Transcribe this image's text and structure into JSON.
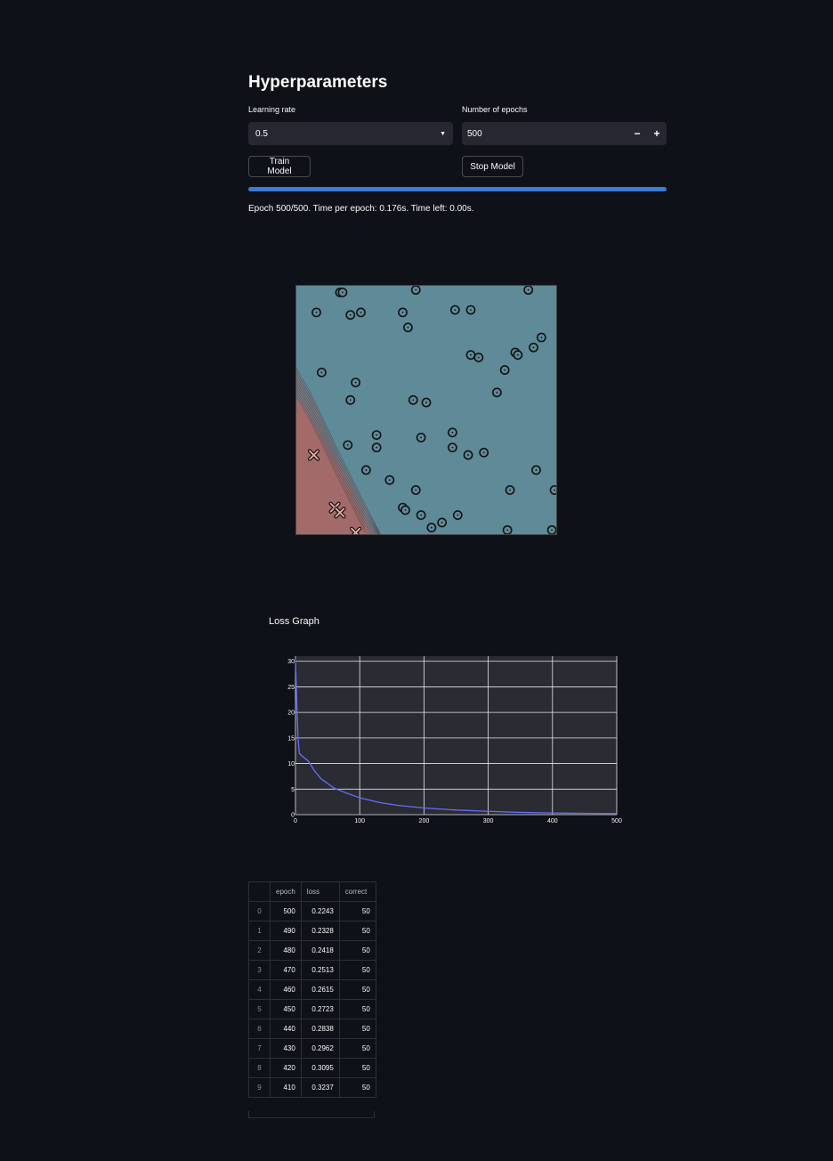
{
  "header": {
    "title": "Hyperparameters"
  },
  "learning_rate": {
    "label": "Learning rate",
    "value": "0.5"
  },
  "epochs": {
    "label": "Number of epochs",
    "value": "500",
    "minus": "−",
    "plus": "+"
  },
  "buttons": {
    "train": "Train Model",
    "stop": "Stop Model"
  },
  "progress": {
    "fraction": 1.0
  },
  "status": "Epoch 500/500. Time per epoch: 0.176s. Time left: 0.00s.",
  "colors": {
    "accent": "#3a7bd5",
    "class_blue": "#5f8a98",
    "class_red": "#a36a6a",
    "line": "#636efa",
    "plot_bg": "#2a2b33"
  },
  "scatter_data": {
    "type": "scatter",
    "classes": [
      "circle",
      "cross"
    ],
    "circles": [
      [
        0.17,
        0.03
      ],
      [
        0.18,
        0.03
      ],
      [
        0.46,
        0.02
      ],
      [
        0.89,
        0.02
      ],
      [
        0.08,
        0.11
      ],
      [
        0.21,
        0.12
      ],
      [
        0.25,
        0.11
      ],
      [
        0.41,
        0.11
      ],
      [
        0.61,
        0.1
      ],
      [
        0.67,
        0.1
      ],
      [
        0.43,
        0.17
      ],
      [
        0.94,
        0.21
      ],
      [
        0.84,
        0.27
      ],
      [
        0.85,
        0.28
      ],
      [
        0.91,
        0.25
      ],
      [
        0.67,
        0.28
      ],
      [
        0.7,
        0.29
      ],
      [
        0.8,
        0.34
      ],
      [
        0.1,
        0.35
      ],
      [
        0.23,
        0.39
      ],
      [
        0.21,
        0.46
      ],
      [
        0.45,
        0.46
      ],
      [
        0.5,
        0.47
      ],
      [
        0.77,
        0.43
      ],
      [
        0.31,
        0.6
      ],
      [
        0.2,
        0.64
      ],
      [
        0.31,
        0.65
      ],
      [
        0.48,
        0.61
      ],
      [
        0.6,
        0.59
      ],
      [
        0.6,
        0.65
      ],
      [
        0.66,
        0.68
      ],
      [
        0.72,
        0.67
      ],
      [
        0.27,
        0.74
      ],
      [
        0.36,
        0.78
      ],
      [
        0.46,
        0.82
      ],
      [
        0.82,
        0.82
      ],
      [
        0.92,
        0.74
      ],
      [
        0.99,
        0.82
      ],
      [
        0.41,
        0.89
      ],
      [
        0.42,
        0.9
      ],
      [
        0.48,
        0.92
      ],
      [
        0.56,
        0.95
      ],
      [
        0.62,
        0.92
      ],
      [
        0.52,
        0.97
      ],
      [
        0.81,
        0.98
      ],
      [
        0.98,
        0.98
      ]
    ],
    "crosses": [
      [
        0.07,
        0.68
      ],
      [
        0.15,
        0.89
      ],
      [
        0.17,
        0.91
      ],
      [
        0.23,
        0.99
      ]
    ]
  },
  "loss_title": "Loss Graph",
  "chart_data": {
    "type": "line",
    "title": "",
    "xlabel": "",
    "ylabel": "",
    "xlim": [
      0,
      500
    ],
    "ylim": [
      0,
      31
    ],
    "xticks": [
      "0",
      "100",
      "200",
      "300",
      "400",
      "500"
    ],
    "yticks": [
      "0",
      "5",
      "10",
      "15",
      "20",
      "25",
      "30"
    ],
    "grid": true,
    "series": [
      {
        "x": [
          0,
          2,
          4,
          6,
          10,
          20,
          30,
          40,
          60,
          80,
          100,
          130,
          160,
          200,
          250,
          300,
          350,
          400,
          450,
          500
        ],
        "y": [
          30.5,
          22,
          15,
          12,
          11.5,
          10.5,
          8.5,
          7,
          5.2,
          4.2,
          3.3,
          2.4,
          1.8,
          1.3,
          0.9,
          0.65,
          0.45,
          0.32,
          0.26,
          0.22
        ]
      }
    ]
  },
  "table": {
    "columns": [
      "",
      "epoch",
      "loss",
      "correct"
    ],
    "rows": [
      [
        "0",
        "500",
        "0.2243",
        "50"
      ],
      [
        "1",
        "490",
        "0.2328",
        "50"
      ],
      [
        "2",
        "480",
        "0.2418",
        "50"
      ],
      [
        "3",
        "470",
        "0.2513",
        "50"
      ],
      [
        "4",
        "460",
        "0.2615",
        "50"
      ],
      [
        "5",
        "450",
        "0.2723",
        "50"
      ],
      [
        "6",
        "440",
        "0.2838",
        "50"
      ],
      [
        "7",
        "430",
        "0.2962",
        "50"
      ],
      [
        "8",
        "420",
        "0.3095",
        "50"
      ],
      [
        "9",
        "410",
        "0.3237",
        "50"
      ]
    ]
  }
}
